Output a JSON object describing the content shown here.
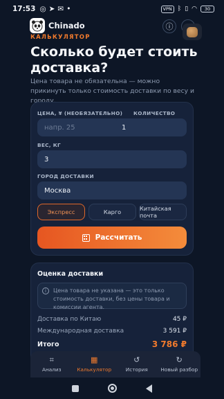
{
  "status_bar": {
    "time": "17:53",
    "vpn_label": "VPN",
    "battery": "30",
    "left_icons": [
      "instagram-icon",
      "telegram-icon",
      "gmail-icon",
      "more-dot-icon"
    ],
    "right_icons": [
      "vpn-icon",
      "bluetooth-icon",
      "vibrate-icon",
      "wifi-icon",
      "battery-icon"
    ]
  },
  "header": {
    "app_name": "Chinado",
    "section_tag": "КАЛЬКУЛЯТОР",
    "info_icon": "info-icon",
    "theme_icon": "moon-icon"
  },
  "main": {
    "title": "Сколько будет стоить доставка?",
    "description": "Цена товара не обязательна — можно прикинуть только стоимость доставки по весу и городу."
  },
  "form": {
    "price_label": "ЦЕНА, ¥ (НЕОБЯЗАТЕЛЬНО)",
    "price_placeholder": "напр. 25",
    "price_value": "",
    "quantity_label": "КОЛИЧЕСТВО",
    "quantity_value": "1",
    "weight_label": "ВЕС, КГ",
    "weight_value": "3",
    "city_label": "ГОРОД ДОСТАВКИ",
    "city_value": "Москва",
    "delivery_types": [
      "Экспресс",
      "Карго",
      "Китайская почта"
    ],
    "selected_delivery": "Экспресс",
    "calculate_label": "Рассчитать"
  },
  "estimate": {
    "title": "Оценка доставки",
    "notice": "Цена товара не указана — это только стоимость доставки, без цены товара и комиссии агента.",
    "rows": [
      {
        "label": "Доставка по Китаю",
        "value": "45 ₽"
      },
      {
        "label": "Международная доставка",
        "value": "3 591 ₽"
      }
    ],
    "total_label": "Итого",
    "total_value": "3 786 ₽"
  },
  "bottom_nav": {
    "items": [
      {
        "label": "Анализ",
        "icon": "scan-icon"
      },
      {
        "label": "Калькулятор",
        "icon": "calculator-icon"
      },
      {
        "label": "История",
        "icon": "history-icon"
      },
      {
        "label": "Новый разбор",
        "icon": "refresh-icon"
      }
    ],
    "active": "Калькулятор"
  },
  "colors": {
    "accent": "#f07a2d",
    "background": "#0d1626",
    "card": "#16223a"
  }
}
